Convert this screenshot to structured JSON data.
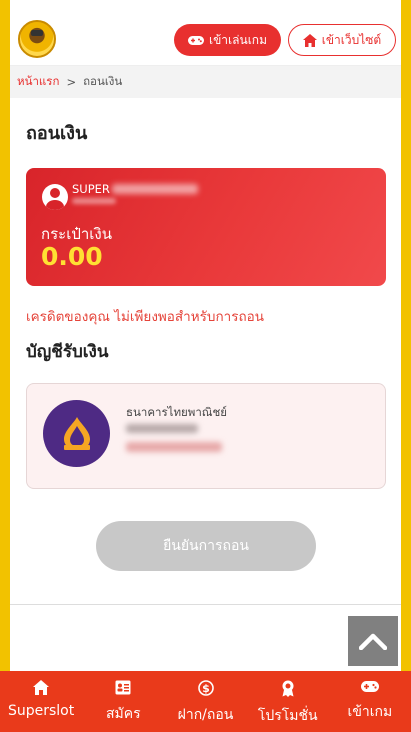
{
  "header": {
    "play_game_label": "เข้าเล่นเกม",
    "website_label": "เข้าเว็บไซต์"
  },
  "breadcrumb": {
    "home": "หน้าแรก",
    "separator": ">",
    "current": "ถอนเงิน"
  },
  "page": {
    "title": "ถอนเงิน"
  },
  "wallet": {
    "username_prefix": "SUPER",
    "label": "กระเป๋าเงิน",
    "amount": "0.00"
  },
  "warning_text": "เครดิตของคุณ ไม่เพียงพอสำหรับการถอน",
  "bank_section": {
    "title": "บัญชีรับเงิน",
    "bank_name": "ธนาคารไทยพาณิชย์"
  },
  "confirm_button_label": "ยืนยันการถอน",
  "bottom_nav": {
    "items": [
      {
        "label": "Superslot",
        "icon": "home-icon"
      },
      {
        "label": "สมัคร",
        "icon": "register-icon"
      },
      {
        "label": "ฝาก/ถอน",
        "icon": "dollar-icon"
      },
      {
        "label": "โปรโมชั่น",
        "icon": "award-icon"
      },
      {
        "label": "เข้าเกม",
        "icon": "gamepad-icon"
      }
    ]
  },
  "colors": {
    "accent_red": "#e8302f",
    "frame_yellow": "#f2c200",
    "wallet_amount": "#ffe033",
    "bank_purple": "#4e2a84",
    "nav_bg": "#e93a1b"
  }
}
